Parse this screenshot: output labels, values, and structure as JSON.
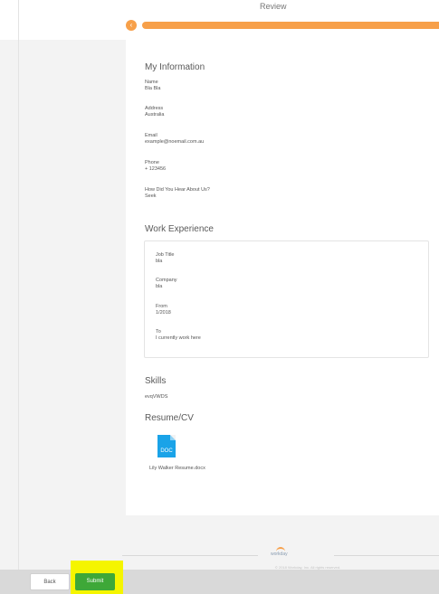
{
  "page": {
    "step_title": "Review"
  },
  "progress": {
    "step_icon": "‹",
    "fraction_complete": 1.0,
    "color": "#f7a04a"
  },
  "my_information": {
    "title": "My Information",
    "fields": [
      {
        "label": "Name",
        "value": "Bla Bla"
      },
      {
        "label": "Address",
        "value": "Australia"
      },
      {
        "label": "Email",
        "value": "example@noemail.com.au"
      },
      {
        "label": "Phone",
        "value": "+ 123456"
      },
      {
        "label": "How Did You Hear About Us?",
        "value": "Seek"
      }
    ]
  },
  "work_experience": {
    "title": "Work Experience",
    "fields": [
      {
        "label": "Job Title",
        "value": "bla"
      },
      {
        "label": "Company",
        "value": "bla"
      },
      {
        "label": "From",
        "value": "1/2018"
      },
      {
        "label": "To",
        "value": "I currently work here"
      }
    ]
  },
  "skills": {
    "title": "Skills",
    "value": "evqVWDS"
  },
  "resume": {
    "title": "Resume/CV",
    "file_type": "DOC",
    "file_name": "Lily Walker Resume.docx"
  },
  "footer": {
    "logo_text": "workday",
    "copyright": "© 2018 Workday, Inc. All rights reserved.",
    "back_label": "Back",
    "submit_label": "Submit",
    "highlight_color": "#f5f500",
    "submit_color": "#3ea838"
  }
}
